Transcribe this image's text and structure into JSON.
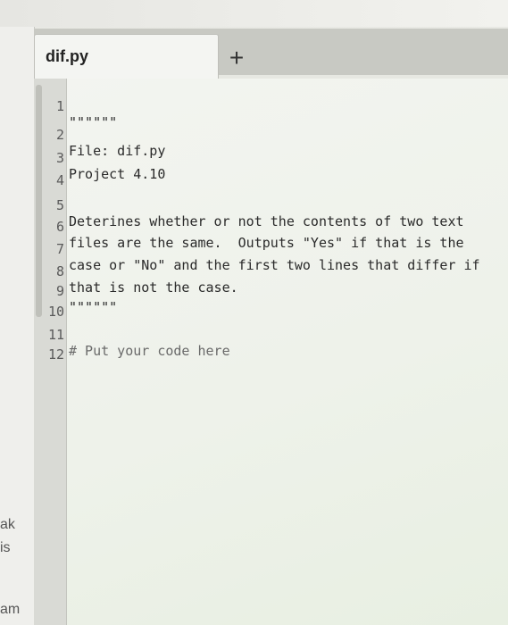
{
  "tab": {
    "title": "dif.py",
    "add_label": "+"
  },
  "sidebar_fragments": [
    "ak",
    "is",
    "am"
  ],
  "lines": [
    {
      "n": "1",
      "text": "\"\"\"\"\"\""
    },
    {
      "n": "2",
      "text": "File: dif.py"
    },
    {
      "n": "3",
      "text": "Project 4.10"
    },
    {
      "n": "4",
      "text": ""
    },
    {
      "n": "5",
      "text": "Deterines whether or not the contents of two text"
    },
    {
      "n": "6",
      "text": "files are the same.  Outputs \"Yes\" if that is the"
    },
    {
      "n": "7",
      "text": "case or \"No\" and the first two lines that differ if"
    },
    {
      "n": "8",
      "text": "that is not the case."
    },
    {
      "n": "9",
      "text": "\"\"\"\"\"\""
    },
    {
      "n": "10",
      "text": ""
    },
    {
      "n": "11",
      "text": "# Put your code here"
    },
    {
      "n": "12",
      "text": ""
    }
  ]
}
